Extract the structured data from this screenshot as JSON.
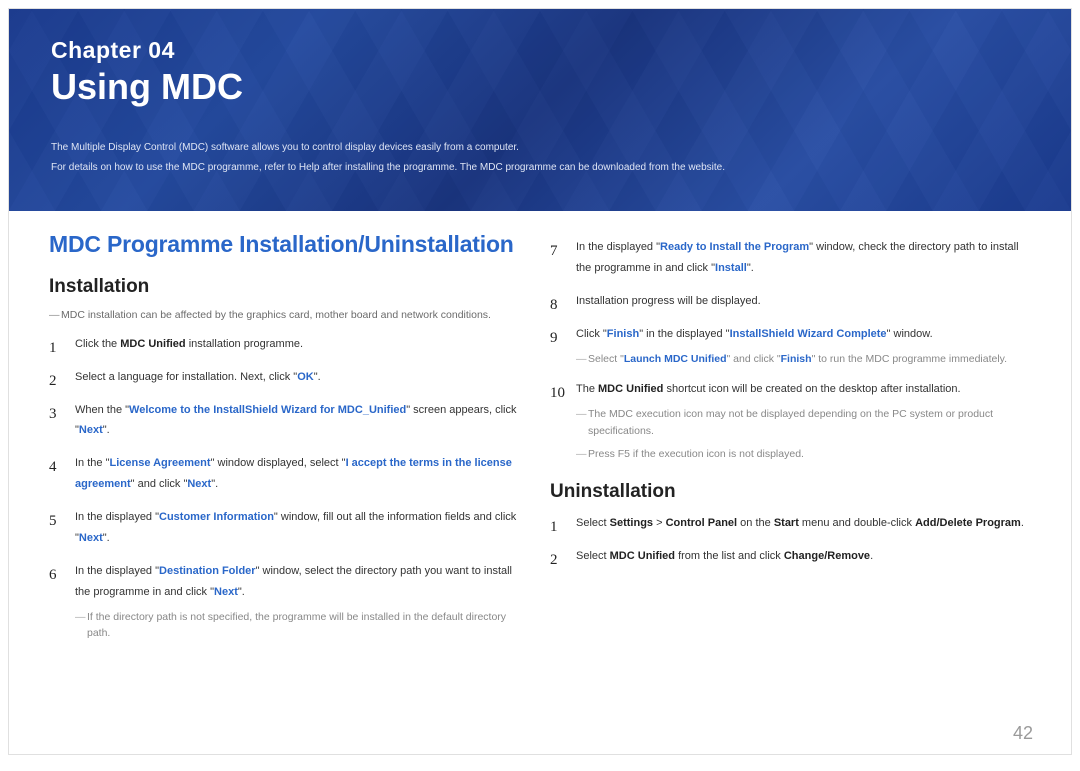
{
  "chapter": {
    "label": "Chapter  04",
    "title": "Using MDC"
  },
  "intro": {
    "p1": "The Multiple Display Control (MDC) software allows you to control display devices easily from a computer.",
    "p2": "For details on how to use the MDC programme, refer to Help after installing the programme. The MDC programme can be downloaded from the website."
  },
  "section_title": "MDC Programme Installation/Uninstallation",
  "installation": {
    "heading": "Installation",
    "note": "MDC installation can be affected by the graphics card, mother board and network conditions.",
    "steps": {
      "s1_a": "Click the ",
      "s1_b": "MDC Unified",
      "s1_c": " installation programme.",
      "s2_a": "Select a language for installation. Next, click \"",
      "s2_b": "OK",
      "s2_c": "\".",
      "s3_a": "When the \"",
      "s3_b": "Welcome to the InstallShield Wizard for MDC_Unified",
      "s3_c": "\" screen appears, click \"",
      "s3_d": "Next",
      "s3_e": "\".",
      "s4_a": "In the \"",
      "s4_b": "License Agreement",
      "s4_c": "\" window displayed, select \"",
      "s4_d": "I accept the terms in the license agreement",
      "s4_e": "\" and click \"",
      "s4_f": "Next",
      "s4_g": "\".",
      "s5_a": "In the displayed \"",
      "s5_b": "Customer Information",
      "s5_c": "\" window, fill out all the information fields and click \"",
      "s5_d": "Next",
      "s5_e": "\".",
      "s6_a": "In the displayed \"",
      "s6_b": "Destination Folder",
      "s6_c": "\" window, select the directory path you want to install the programme in and click \"",
      "s6_d": "Next",
      "s6_e": "\".",
      "s6_note": "If the directory path is not specified, the programme will be installed in the default directory path.",
      "s7_a": "In the displayed \"",
      "s7_b": "Ready to Install the Program",
      "s7_c": "\" window, check the directory path to install the programme in and click \"",
      "s7_d": "Install",
      "s7_e": "\".",
      "s8": "Installation progress will be displayed.",
      "s9_a": "Click \"",
      "s9_b": "Finish",
      "s9_c": "\" in the displayed \"",
      "s9_d": "InstallShield Wizard Complete",
      "s9_e": "\" window.",
      "s9_note_a": "Select \"",
      "s9_note_b": "Launch MDC Unified",
      "s9_note_c": "\" and click \"",
      "s9_note_d": "Finish",
      "s9_note_e": "\" to run the MDC programme immediately.",
      "s10_a": "The ",
      "s10_b": "MDC Unified",
      "s10_c": " shortcut icon will be created on the desktop after installation.",
      "s10_note1": "The MDC execution icon may not be displayed depending on the PC system or product specifications.",
      "s10_note2": "Press F5 if the execution icon is not displayed."
    }
  },
  "uninstallation": {
    "heading": "Uninstallation",
    "steps": {
      "u1_a": "Select ",
      "u1_b": "Settings",
      "u1_c": " > ",
      "u1_d": "Control Panel",
      "u1_e": " on the ",
      "u1_f": "Start",
      "u1_g": " menu and double-click ",
      "u1_h": "Add/Delete Program",
      "u1_i": ".",
      "u2_a": "Select ",
      "u2_b": "MDC Unified",
      "u2_c": " from the list and click ",
      "u2_d": "Change/Remove",
      "u2_e": "."
    }
  },
  "page_number": "42"
}
